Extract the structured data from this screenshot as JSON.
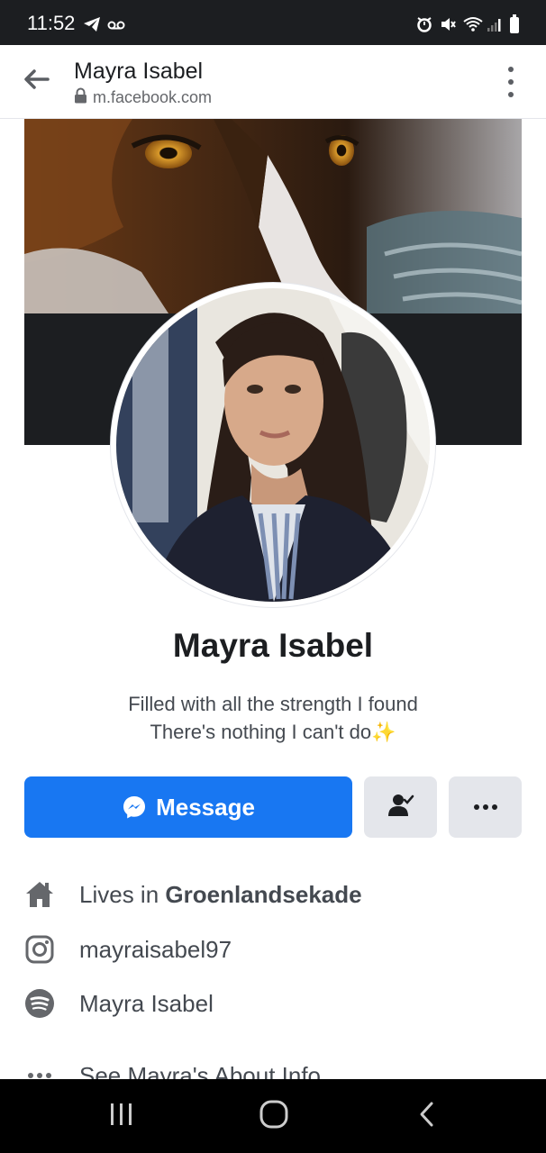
{
  "status_bar": {
    "time": "11:52",
    "icons": [
      "telegram-icon",
      "voicemail-icon",
      "alarm-icon",
      "mute-icon",
      "wifi-icon",
      "signal-icon",
      "battery-icon"
    ]
  },
  "browser": {
    "page_title": "Mayra Isabel",
    "url": "m.facebook.com",
    "icons": [
      "back-arrow-icon",
      "lock-icon",
      "kebab-menu-icon"
    ]
  },
  "profile": {
    "name": "Mayra Isabel",
    "bio_line1": "Filled with all the strength I found",
    "bio_line2": "There's nothing I can't do",
    "bio_emoji": "✨"
  },
  "actions": {
    "message_label": "Message",
    "icons": [
      "messenger-icon",
      "friends-icon",
      "more-dots-icon"
    ]
  },
  "info": {
    "lives_prefix": "Lives in ",
    "lives_place": "Groenlandsekade",
    "instagram": "mayraisabel97",
    "spotify": "Mayra Isabel",
    "see_about": "See Mayra's About Info"
  },
  "colors": {
    "brand_blue": "#1877f2",
    "button_gray": "#e4e6eb",
    "text_secondary": "#444950",
    "status_bar": "#1c1e21"
  }
}
